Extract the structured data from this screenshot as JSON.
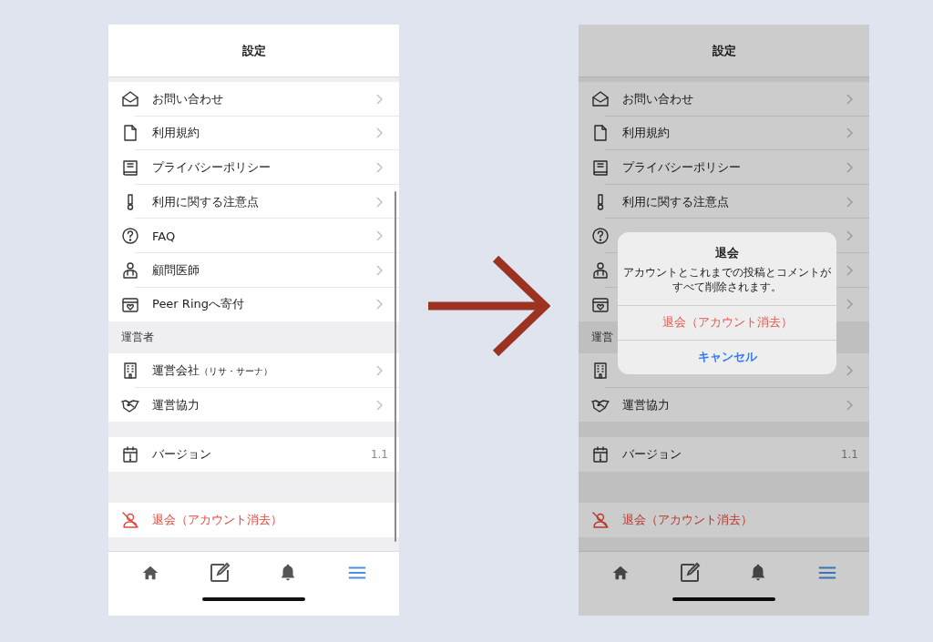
{
  "screens": [
    {
      "title": "設定",
      "sections": [
        {
          "rows": [
            {
              "kind": "link",
              "label": "お問い合わせ"
            },
            {
              "kind": "link",
              "label": "利用規約"
            },
            {
              "kind": "link",
              "label": "プライバシーポリシー"
            },
            {
              "kind": "link",
              "label": "利用に関する注意点"
            },
            {
              "kind": "link",
              "label": "FAQ"
            },
            {
              "kind": "link",
              "label": "顧問医師"
            },
            {
              "kind": "link",
              "label": "Peer Ringへ寄付"
            }
          ]
        },
        {
          "header": "運営者",
          "rows": [
            {
              "kind": "link",
              "label": "運営会社",
              "note": "（リサ・サーナ）"
            },
            {
              "kind": "link",
              "label": "運営協力"
            }
          ]
        },
        {
          "rows": [
            {
              "kind": "value",
              "label": "バージョン",
              "value": "1.1"
            }
          ]
        },
        {
          "rows": [
            {
              "kind": "danger",
              "label": "退会（アカウント消去）"
            }
          ]
        }
      ],
      "tabs": [
        {
          "selected": false
        },
        {
          "selected": false
        },
        {
          "selected": false
        },
        {
          "selected": true
        }
      ]
    },
    {
      "title": "設定",
      "sections": [
        {
          "rows": [
            {
              "kind": "link",
              "label": "お問い合わせ"
            },
            {
              "kind": "link",
              "label": "利用規約"
            },
            {
              "kind": "link",
              "label": "プライバシーポリシー"
            },
            {
              "kind": "link",
              "label": "利用に関する注意点"
            },
            {
              "kind": "link"
            },
            {
              "kind": "link"
            },
            {
              "kind": "link"
            }
          ]
        },
        {
          "header": "運営",
          "rows": [
            {
              "kind": "link"
            },
            {
              "kind": "link",
              "label": "運営協力"
            }
          ]
        },
        {
          "rows": [
            {
              "kind": "value",
              "label": "バージョン",
              "value": "1.1"
            }
          ]
        },
        {
          "rows": [
            {
              "kind": "danger",
              "label": "退会（アカウント消去）"
            }
          ]
        }
      ],
      "tabs": [
        {
          "selected": false
        },
        {
          "selected": false
        },
        {
          "selected": false
        },
        {
          "selected": true
        }
      ],
      "dialog": {
        "title": "退会",
        "message": "アカウントとこれまでの投稿とコメントがすべて削除されます。",
        "buttons": [
          {
            "kind": "destructive",
            "label": "退会（アカウント消去）"
          },
          {
            "kind": "cancel",
            "label": "キャンセル"
          }
        ]
      }
    }
  ]
}
